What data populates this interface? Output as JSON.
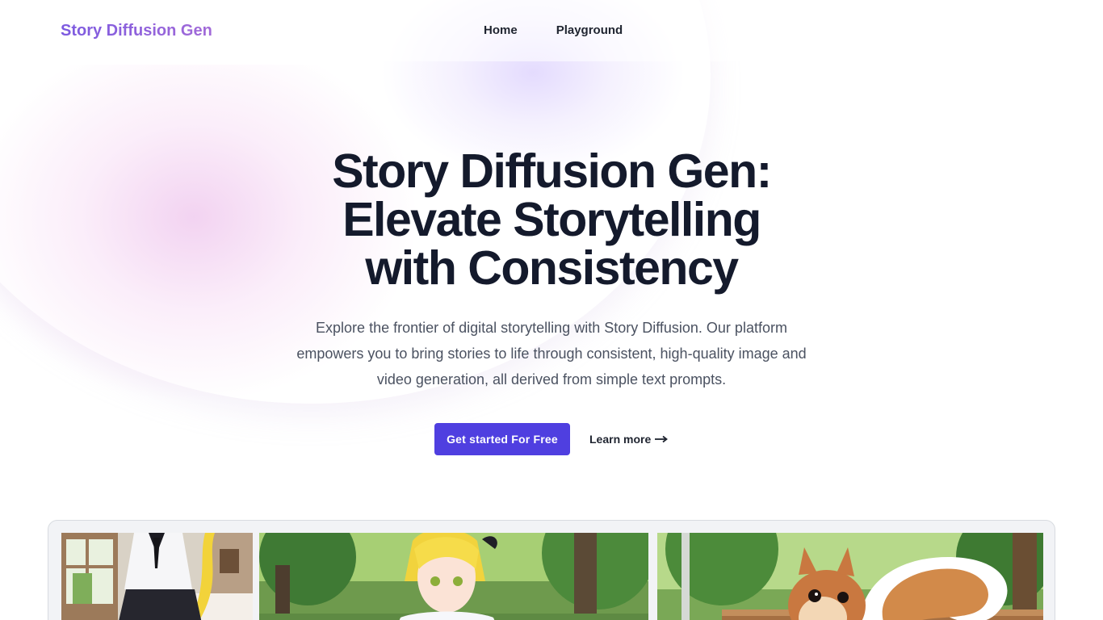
{
  "header": {
    "brand": "Story Diffusion Gen",
    "nav": [
      {
        "label": "Home"
      },
      {
        "label": "Playground"
      }
    ]
  },
  "hero": {
    "title_lines": [
      "Story Diffusion Gen:",
      "Elevate Storytelling",
      "with Consistency"
    ],
    "description_lines": [
      "Explore the frontier of digital storytelling with Story Diffusion. Our platform",
      "empowers you to bring stories to life through consistent, high-quality image and",
      "video generation, all derived from simple text prompts."
    ],
    "cta_primary": "Get started For Free",
    "cta_secondary": "Learn more",
    "arrow_icon": "arrow-right-icon"
  },
  "gallery": {
    "images": [
      {
        "subject": "anime girl in school uniform in a room"
      },
      {
        "subject": "anime girl with yellow hair in a park"
      },
      {
        "subject": "squirrel on a park bench"
      }
    ]
  },
  "colors": {
    "brand_gradient_start": "#7c5ae0",
    "brand_gradient_end": "#a26ad8",
    "primary_button": "#4f3fe0",
    "title_text": "#141a2c",
    "body_text": "#4b5261"
  }
}
